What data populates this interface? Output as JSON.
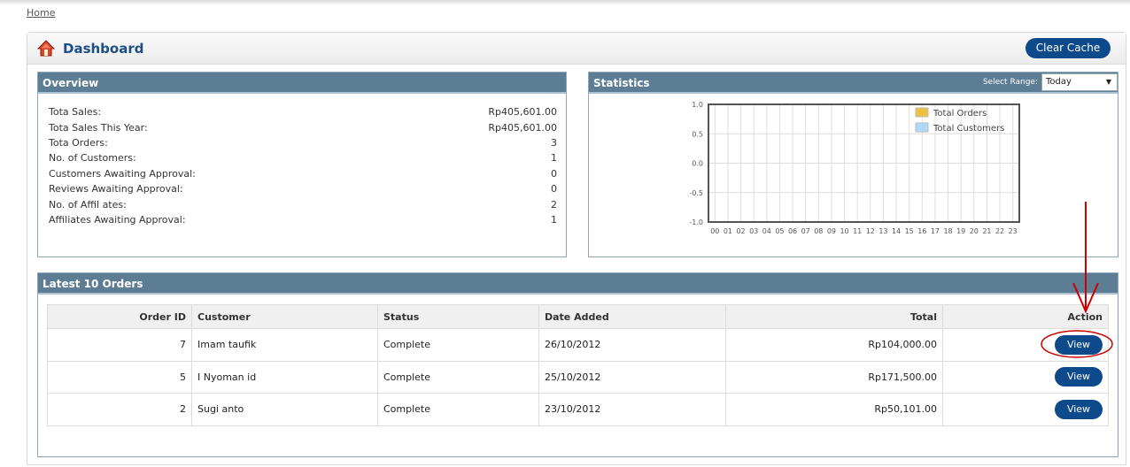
{
  "breadcrumb": "Home",
  "header": {
    "title": "Dashboard",
    "clear_cache": "Clear Cache"
  },
  "overview": {
    "title": "Overview",
    "rows": [
      {
        "label": "Tota Sales:",
        "value": "Rp405,601.00"
      },
      {
        "label": "Tota Sales This Year:",
        "value": "Rp405,601.00"
      },
      {
        "label": "Tota Orders:",
        "value": "3"
      },
      {
        "label": "No. of Customers:",
        "value": "1"
      },
      {
        "label": "Customers Awaiting Approval:",
        "value": "0"
      },
      {
        "label": "Reviews Awaiting Approval:",
        "value": "0"
      },
      {
        "label": "No. of Affil ates:",
        "value": "2"
      },
      {
        "label": "Affiliates Awaiting Approval:",
        "value": "1"
      }
    ]
  },
  "statistics": {
    "title": "Statistics",
    "range_label": "Select Range:",
    "range_value": "Today"
  },
  "chart_data": {
    "type": "line",
    "x": [
      "00",
      "01",
      "02",
      "03",
      "04",
      "05",
      "06",
      "07",
      "08",
      "09",
      "10",
      "11",
      "12",
      "13",
      "14",
      "15",
      "16",
      "17",
      "18",
      "19",
      "20",
      "21",
      "22",
      "23"
    ],
    "y_ticks": [
      "1.0",
      "0.5",
      "0.0",
      "-0.5",
      "-1.0"
    ],
    "ylim": [
      -1.0,
      1.0
    ],
    "grid": true,
    "legend_position": "top-right",
    "series": [
      {
        "name": "Total Orders",
        "color": "#edc240",
        "values": []
      },
      {
        "name": "Total Customers",
        "color": "#afd8f8",
        "values": []
      }
    ]
  },
  "latest": {
    "title": "Latest 10 Orders",
    "columns": [
      "Order ID",
      "Customer",
      "Status",
      "Date Added",
      "Total",
      "Action"
    ],
    "rows": [
      {
        "id": "7",
        "customer": "Imam taufik",
        "status": "Complete",
        "date": "26/10/2012",
        "total": "Rp104,000.00",
        "action": "View"
      },
      {
        "id": "5",
        "customer": "I Nyoman id",
        "status": "Complete",
        "date": "25/10/2012",
        "total": "Rp171,500.00",
        "action": "View"
      },
      {
        "id": "2",
        "customer": "Sugi anto",
        "status": "Complete",
        "date": "23/10/2012",
        "total": "Rp50,101.00",
        "action": "View"
      }
    ]
  },
  "colors": {
    "brand": "#0d4a8c",
    "panel_header": "#5d7d94",
    "annotation": "#cc0000"
  }
}
